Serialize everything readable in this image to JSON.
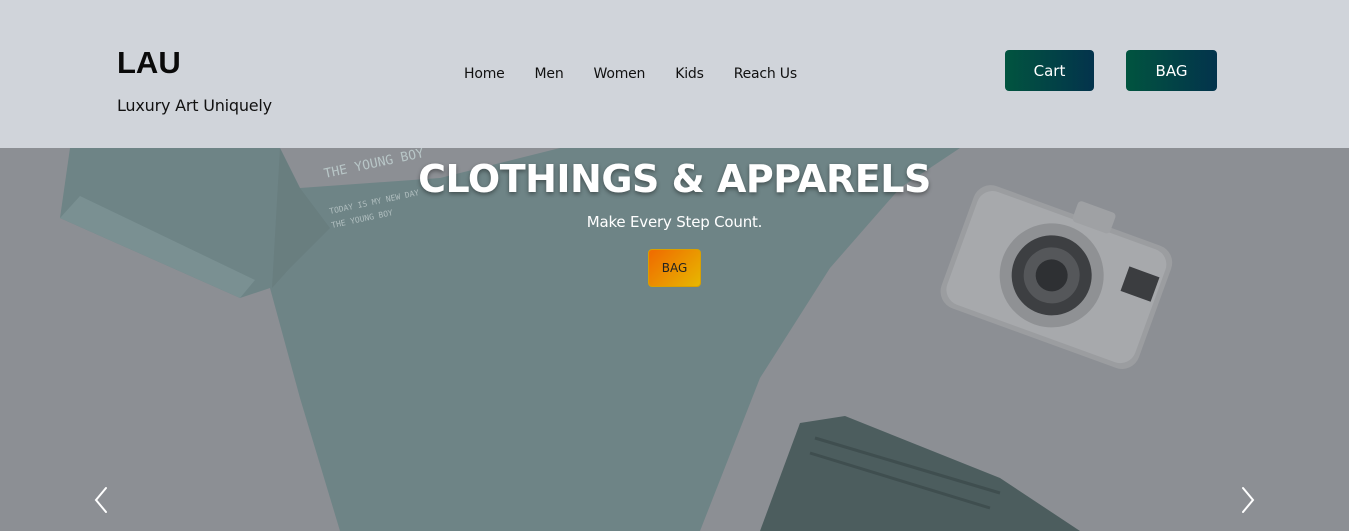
{
  "brand": {
    "name": "LAU",
    "tagline": "Luxury Art Uniquely"
  },
  "nav": {
    "items": [
      "Home",
      "Men",
      "Women",
      "Kids",
      "Reach Us"
    ]
  },
  "header_buttons": {
    "cart": "Cart",
    "bag": "BAG"
  },
  "hero": {
    "title": "CLOTHINGS & APPARELS",
    "subtitle": "Make Every Step Count.",
    "button": "BAG",
    "shirt_print_line1": "THE YOUNG BOY",
    "shirt_print_line2": "TODAY IS MY NEW DAY",
    "shirt_print_line3": "THE YOUNG BOY"
  },
  "carousel": {
    "prev_icon": "chevron-left-icon",
    "next_icon": "chevron-right-icon"
  },
  "colors": {
    "header_bg": "#d0d4da",
    "button_gradient_start": "#01543f",
    "button_gradient_end": "#03334c",
    "hero_button_start": "#f06a00",
    "hero_button_end": "#e7b700"
  }
}
